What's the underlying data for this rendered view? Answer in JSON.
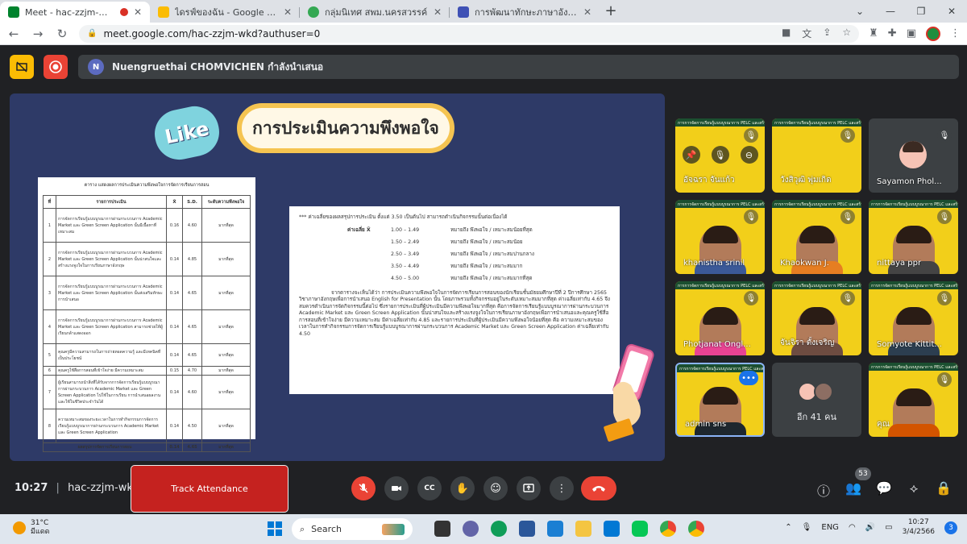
{
  "browser": {
    "tabs": [
      {
        "label": "Meet - hac-zzjm-wkd",
        "favicon_color": "#00832d"
      },
      {
        "label": "ไดรฟ์ของฉัน - Google ไดรฟ์",
        "favicon_color": "#fbbc04"
      },
      {
        "label": "กลุ่มนิเทศ สพม.นครสวรรค์",
        "favicon_color": "#34a853"
      },
      {
        "label": "การพัฒนาทักษะภาษาอังกฤษ English",
        "favicon_color": "#3f51b5"
      }
    ],
    "url": "meet.google.com/hac-zzjm-wkd?authuser=0"
  },
  "presenter": {
    "initial": "N",
    "text": "Nuengruethai CHOMVICHEN กำลังนำเสนอ"
  },
  "slide": {
    "like_text": "Like",
    "title": "การประเมินความพึงพอใจ",
    "table": {
      "caption": "ตาราง แสดงผลการประเมินความพึงพอใจการจัดการเรียนการสอน",
      "headers": [
        "ที่",
        "รายการประเมิน",
        "X̄",
        "S.D.",
        "ระดับความพึงพอใจ"
      ],
      "rows": [
        {
          "no": "1",
          "item": "การจัดการเรียนรู้แบบบูรณาการผ่านกระบวนการ Academic Market และ Green Screen Application นั้นมีเนื้อหาที่เหมาะสม",
          "mean": "0.16",
          "sd": "4.60",
          "level": "มากที่สุด",
          "size": "big"
        },
        {
          "no": "2",
          "item": "การจัดการเรียนรู้แบบบูรณาการผ่านกระบวนการ Academic Market และ Green Screen Application นั้นน่าสนใจและสร้างแรงจูงใจในการเรียนภาษาอังกฤษ",
          "mean": "0.14",
          "sd": "4.85",
          "level": "มากที่สุด",
          "size": "big"
        },
        {
          "no": "3",
          "item": "การจัดการเรียนรู้แบบบูรณาการผ่านกระบวนการ Academic Market และ Green Screen Application นั้นส่งเสริมทักษะการนำเสนอ",
          "mean": "0.14",
          "sd": "4.65",
          "level": "มากที่สุด",
          "size": "big"
        },
        {
          "no": "4",
          "item": "การจัดการเรียนรู้แบบบูรณาการผ่านกระบวนการ Academic Market และ Green Screen Application สามารถช่วยให้ผู้เรียนกล้าแสดงออก",
          "mean": "0.14",
          "sd": "4.65",
          "level": "มากที่สุด",
          "size": "big"
        },
        {
          "no": "5",
          "item": "คุณครูมีความสามารถในการถ่ายทอดความรู้ และมีเทคนิคที่เป็นประโยชน์",
          "mean": "0.14",
          "sd": "4.65",
          "level": "มากที่สุด",
          "size": "med"
        },
        {
          "no": "6",
          "item": "คุณครูใช้สื่อการสอนที่เข้าใจง่าย มีความเหมาะสม",
          "mean": "0.15",
          "sd": "4.70",
          "level": "มากที่สุด",
          "size": "sm"
        },
        {
          "no": "7",
          "item": "ผู้เรียนสามารถนำสิ่งที่ได้รับจากการจัดการเรียนรู้แบบบูรณาการผ่านกระบวนการ Academic Market และ Green Screen Application ไปใช้ในการเรียน การนำเสนอผลงาน และใช้ในชีวิตประจำวันได้",
          "mean": "0.14",
          "sd": "4.60",
          "level": "มากที่สุด",
          "size": "big"
        },
        {
          "no": "8",
          "item": "ความเหมาะสมของระยะเวลาในการทำกิจกรรมการจัดการเรียนรู้แบบบูรณาการผ่านกระบวนการ Academic Market และ Green Screen Application",
          "mean": "0.14",
          "sd": "4.50",
          "level": "มากที่สุด",
          "size": "big"
        }
      ],
      "total": {
        "label": "ผลสรุปการจัดการเรียนการสอน",
        "mean": "0.14",
        "sd": "4.65",
        "level": "มากที่สุด"
      }
    },
    "text_doc": {
      "note": "*** ค่าเฉลี่ยของผลสรุปการประเมิน ตั้งแต่ 3.50 เป็นต้นไป สามารถดำเนินกิจกรรมนั้นต่อเนื่องได้",
      "scale_label": "ค่าเฉลี่ย X̄",
      "scale": [
        {
          "range": "1.00 – 1.49",
          "meaning": "หมายถึง   พึงพอใจ / เหมาะสมน้อยที่สุด"
        },
        {
          "range": "1.50 – 2.49",
          "meaning": "หมายถึง   พึงพอใจ / เหมาะสมน้อย"
        },
        {
          "range": "2.50 – 3.49",
          "meaning": "หมายถึง   พึงพอใจ / เหมาะสมปานกลาง"
        },
        {
          "range": "3.50 – 4.49",
          "meaning": "หมายถึง   พึงพอใจ / เหมาะสมมาก"
        },
        {
          "range": "4.50 – 5.00",
          "meaning": "หมายถึง   พึงพอใจ / เหมาะสมมากที่สุด"
        }
      ],
      "paragraph": "จากตารางจะเห็นได้ว่า การประเมินความพึงพอใจในการจัดการเรียนการสอนของนักเรียนชั้นมัธยมศึกษาปีที่ 2 ปีการศึกษา 2565 วิชาภาษาอังกฤษเพื่อการนำเสนอ English for Presentation นั้น โดยภาพรวมทั้งกิจกรรมอยู่ในระดับเหมาะสมมากที่สุด ค่าเฉลี่ยเท่ากับ 4.65 จึงสมควรดำเนินการจัดกิจกรรมนี้ต่อไป ซึ่งรายการประเมินที่ผู้ประเมินมีความพึงพอใจมากที่สุด คือการจัดการเรียนรู้แบบบูรณาการผ่านกระบวนการ Academic Market และ Green Screen Application นั้นน่าสนใจและสร้างแรงจูงใจในการเรียนภาษาอังกฤษเพื่อการนำเสนอและคุณครูใช้สื่อการสอนที่เข้าใจง่าย มีความเหมาะสม มีค่าเฉลี่ยเท่ากับ 4.85 และรายการประเมินที่ผู้ประเมินมีความพึงพอใจน้อยที่สุด คือ ความเหมาะสมของเวลาในการทำกิจกรรมการจัดการเรียนรู้แบบบูรณาการผ่านกระบวนการ Academic Market และ Green Screen Application ค่าเฉลี่ยเท่ากับ 4.50"
    }
  },
  "participants": [
    {
      "name": "อัจฉรา จันแก้ว",
      "bg": "yellow"
    },
    {
      "name": "วังสิวุฒิ พุ่มเกิด",
      "bg": "yellow"
    },
    {
      "name": "Sayamon Phol...",
      "bg": "gray"
    },
    {
      "name": "khanistha srinil",
      "bg": "yellow"
    },
    {
      "name": "Khaokwan J.",
      "bg": "yellow"
    },
    {
      "name": "nittaya ppr",
      "bg": "yellow"
    },
    {
      "name": "Photjanat Ongl...",
      "bg": "yellow"
    },
    {
      "name": "จันจิรา ตั้งเจริญ",
      "bg": "yellow"
    },
    {
      "name": "Somyote Kittit...",
      "bg": "yellow"
    },
    {
      "name": "admin sns",
      "bg": "yellow"
    },
    {
      "name": "อีก 41 คน",
      "bg": "gray"
    },
    {
      "name": "คุณ",
      "bg": "yellow"
    }
  ],
  "banner_text": "การการจัดการเรียนรู้แบบบูรณาการ PELC และสร้างสรรค์ภาษา",
  "controls": {
    "time": "10:27",
    "meeting_code": "hac-zzjm-wkd",
    "track_attendance": "Track Attendance",
    "people_count": "53"
  },
  "taskbar": {
    "temp": "31°C",
    "weather": "มีแดด",
    "search": "Search",
    "lang": "ENG",
    "clock_time": "10:27",
    "clock_date": "3/4/2566",
    "notifications": "3"
  }
}
